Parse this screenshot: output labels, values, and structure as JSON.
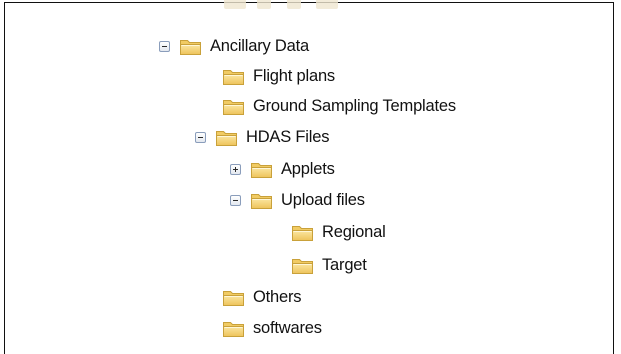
{
  "tree": {
    "nodes": [
      {
        "label": "Ancillary Data",
        "toggle": "minus",
        "icon": "folder-icon"
      },
      {
        "label": "Flight plans",
        "toggle": "none",
        "icon": "folder-icon"
      },
      {
        "label": "Ground Sampling Templates",
        "toggle": "none",
        "icon": "folder-icon"
      },
      {
        "label": "HDAS Files",
        "toggle": "minus",
        "icon": "folder-icon"
      },
      {
        "label": "Applets",
        "toggle": "plus",
        "icon": "folder-icon"
      },
      {
        "label": "Upload files",
        "toggle": "minus",
        "icon": "folder-icon"
      },
      {
        "label": "Regional",
        "toggle": "none",
        "icon": "folder-icon"
      },
      {
        "label": "Target",
        "toggle": "none",
        "icon": "folder-icon"
      },
      {
        "label": "Others",
        "toggle": "none",
        "icon": "folder-icon"
      },
      {
        "label": "softwares",
        "toggle": "none",
        "icon": "folder-icon"
      }
    ]
  },
  "colors": {
    "folder_body": "#f5d372",
    "folder_edge": "#c9a13a",
    "toggle_border": "#8a9dbb",
    "text": "#111111"
  }
}
